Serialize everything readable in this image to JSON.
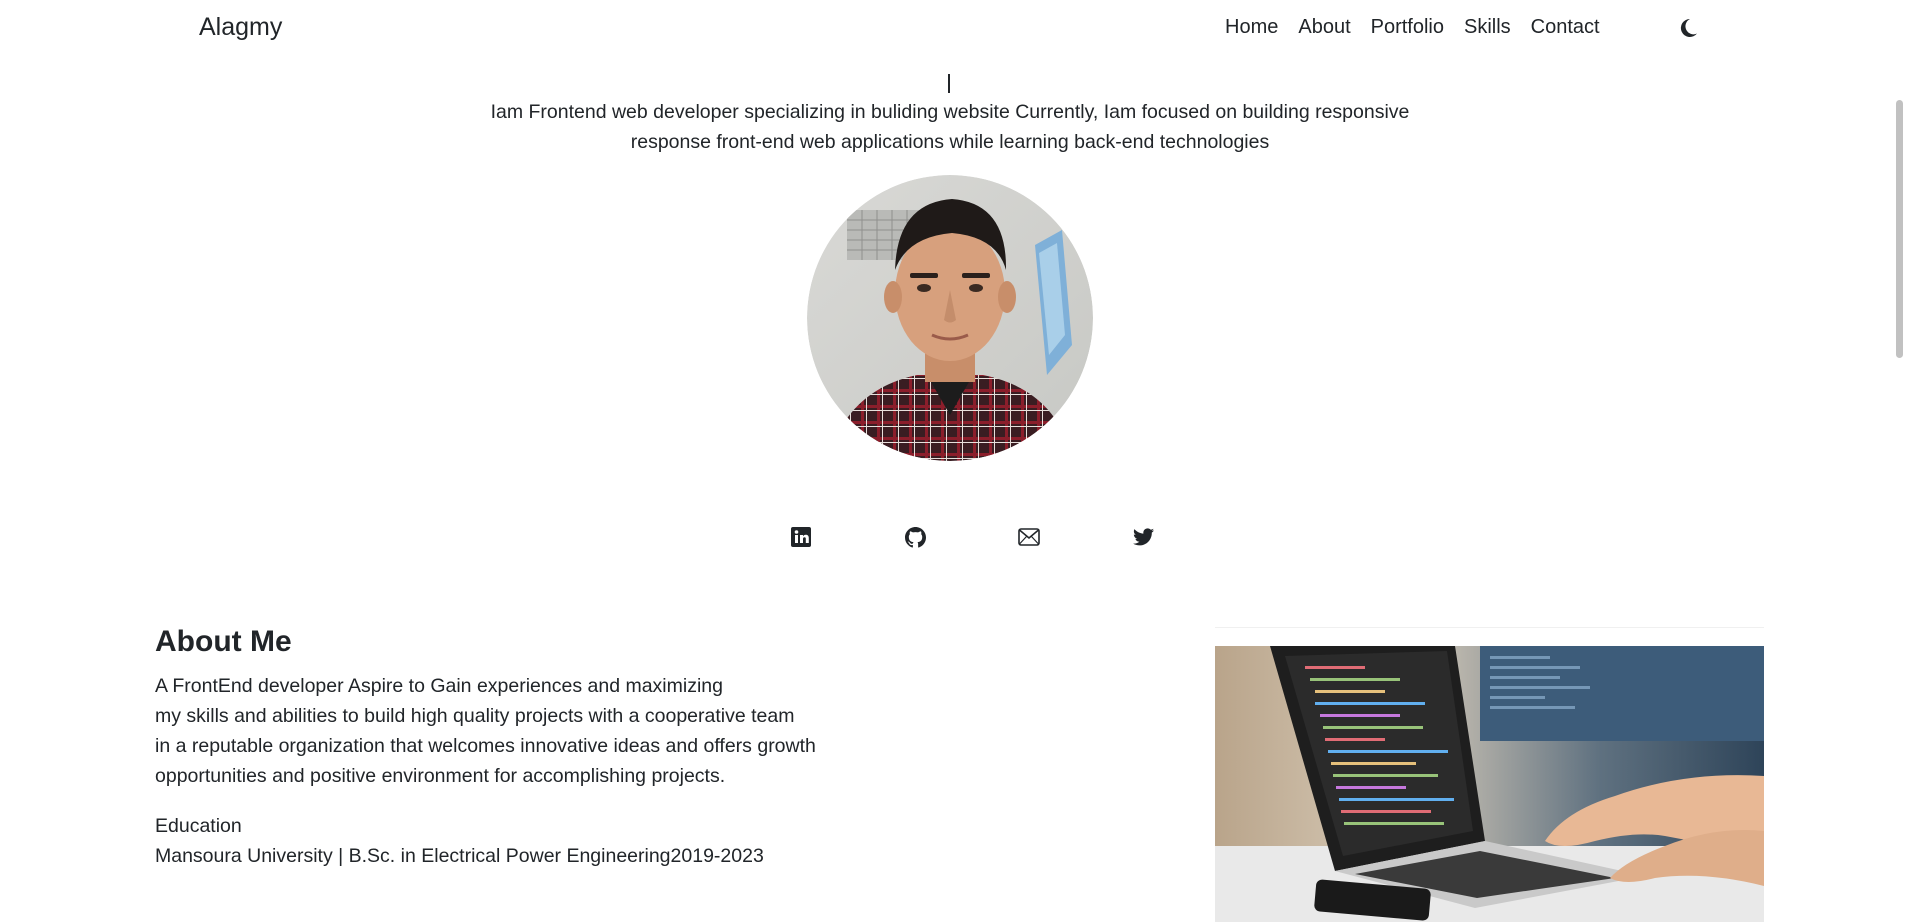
{
  "navbar": {
    "brand": "Alagmy",
    "links": [
      "Home",
      "About",
      "Portfolio",
      "Skills",
      "Contact"
    ],
    "theme_icon": "moon-icon"
  },
  "hero": {
    "typed_cursor": "|",
    "line1": "Iam Frontend web developer specializing in buliding website Currently, Iam focused on building responsive",
    "line2": "response front-end web applications while learning back-end technologies",
    "avatar_icon": "profile-photo",
    "social_icons": [
      "linkedin-icon",
      "github-icon",
      "mail-icon",
      "twitter-icon"
    ]
  },
  "about": {
    "title": "About Me",
    "lines": [
      "A FrontEnd developer Aspire to Gain experiences and maximizing",
      "my skills and abilities to build high quality projects with a cooperative team",
      "in a reputable organization that welcomes innovative ideas and offers growth",
      "opportunities and positive environment for accomplishing projects."
    ],
    "education_label": "Education",
    "education_detail": "Mansoura University | B.Sc. in Electrical Power Engineering2019-2023",
    "image_icon": "laptop-coding-photo"
  },
  "colors": {
    "text": "#212529",
    "background": "#ffffff"
  }
}
